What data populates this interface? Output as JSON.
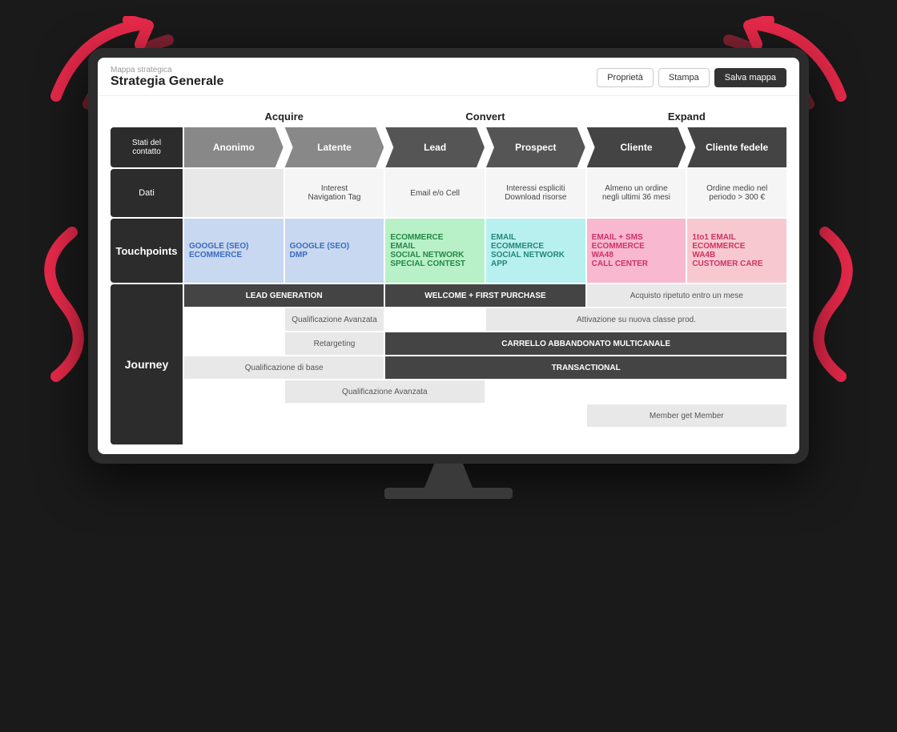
{
  "app": {
    "breadcrumb": "Mappa strategica",
    "title": "Strategia Generale",
    "buttons": {
      "properties": "Proprietà",
      "print": "Stampa",
      "save": "Salva mappa"
    }
  },
  "phases": [
    {
      "id": "acquire",
      "label": "Acquire",
      "columns": [
        0,
        1
      ]
    },
    {
      "id": "convert",
      "label": "Convert",
      "columns": [
        2,
        3
      ]
    },
    {
      "id": "expand",
      "label": "Expand",
      "columns": [
        4,
        5
      ]
    }
  ],
  "stages": [
    {
      "id": "anonimo",
      "label": "Anonimo",
      "class": "stage-anonimo first"
    },
    {
      "id": "latente",
      "label": "Latente",
      "class": "stage-latente"
    },
    {
      "id": "lead",
      "label": "Lead",
      "class": "stage-lead"
    },
    {
      "id": "prospect",
      "label": "Prospect",
      "class": "stage-prospect"
    },
    {
      "id": "cliente",
      "label": "Cliente",
      "class": "stage-cliente"
    },
    {
      "id": "fedele",
      "label": "Cliente fedele",
      "class": "stage-fedele last"
    }
  ],
  "rows": {
    "stati": "Stati del contatto",
    "dati": "Dati",
    "touchpoints": "Touchpoints",
    "journey": "Journey"
  },
  "data_row": [
    {
      "text": "",
      "empty": true
    },
    {
      "text": "Interest\nNavigation Tag",
      "empty": false
    },
    {
      "text": "Email e/o Cell",
      "empty": false
    },
    {
      "text": "Interessi espliciti\nDownload risorse",
      "empty": false
    },
    {
      "text": "Almeno un ordine\nnegli ultimi 36 mesi",
      "empty": false
    },
    {
      "text": "Ordine medio nel\nperiodo > 300 €",
      "empty": false
    }
  ],
  "touchpoints": [
    {
      "lines": [
        "GOOGLE (SEO)",
        "ECOMMERCE"
      ],
      "class": "tp-anonimo"
    },
    {
      "lines": [
        "GOOGLE (SEO)",
        "DMP"
      ],
      "class": "tp-latente"
    },
    {
      "lines": [
        "ECOMMERCE",
        "EMAIL",
        "SOCIAL NETWORK",
        "SPECIAL CONTEST"
      ],
      "class": "tp-lead"
    },
    {
      "lines": [
        "EMAIL",
        "ECOMMERCE",
        "SOCIAL NETWORK",
        "APP"
      ],
      "class": "tp-prospect"
    },
    {
      "lines": [
        "EMAIL + SMS",
        "ECOMMERCE",
        "WA48",
        "CALL CENTER"
      ],
      "class": "tp-cliente"
    },
    {
      "lines": [
        "1to1 EMAIL",
        "ECOMMERCE",
        "WA4B",
        "CUSTOMER CARE"
      ],
      "class": "tp-fedele"
    }
  ],
  "journey_items": [
    {
      "row": 1,
      "text": "LEAD GENERATION",
      "style": "dark",
      "span": 2
    },
    {
      "row": 1,
      "text": "WELCOME + FIRST PURCHASE",
      "style": "dark",
      "span": 2
    },
    {
      "row": 1,
      "text": "Acquisto ripetuto entro un mese",
      "style": "light",
      "span": 2
    },
    {
      "row": 2,
      "text": "",
      "style": "empty",
      "span": 1
    },
    {
      "row": 2,
      "text": "Qualificazione Avanzata",
      "style": "light",
      "span": 1
    },
    {
      "row": 2,
      "text": "",
      "style": "empty",
      "span": 1
    },
    {
      "row": 2,
      "text": "Attivazione su nuova classe prod.",
      "style": "light",
      "span": 2
    },
    {
      "row": 3,
      "text": "Retargeting",
      "style": "light",
      "span": 1,
      "offset": 1
    },
    {
      "row": 3,
      "text": "CARRELLO ABBANDONATO MULTICANALE",
      "style": "dark",
      "span": 4
    },
    {
      "row": 4,
      "text": "Qualificazione di base",
      "style": "light",
      "span": 2
    },
    {
      "row": 4,
      "text": "TRANSACTIONAL",
      "style": "dark",
      "span": 4
    },
    {
      "row": 5,
      "text": "",
      "style": "empty",
      "span": 1
    },
    {
      "row": 5,
      "text": "Qualificazione Avanzata",
      "style": "light",
      "span": 2
    },
    {
      "row": 5,
      "text": "",
      "style": "empty",
      "span": 3
    },
    {
      "row": 6,
      "text": "",
      "style": "empty",
      "span": 4
    },
    {
      "row": 6,
      "text": "Member get Member",
      "style": "light",
      "span": 2
    }
  ]
}
